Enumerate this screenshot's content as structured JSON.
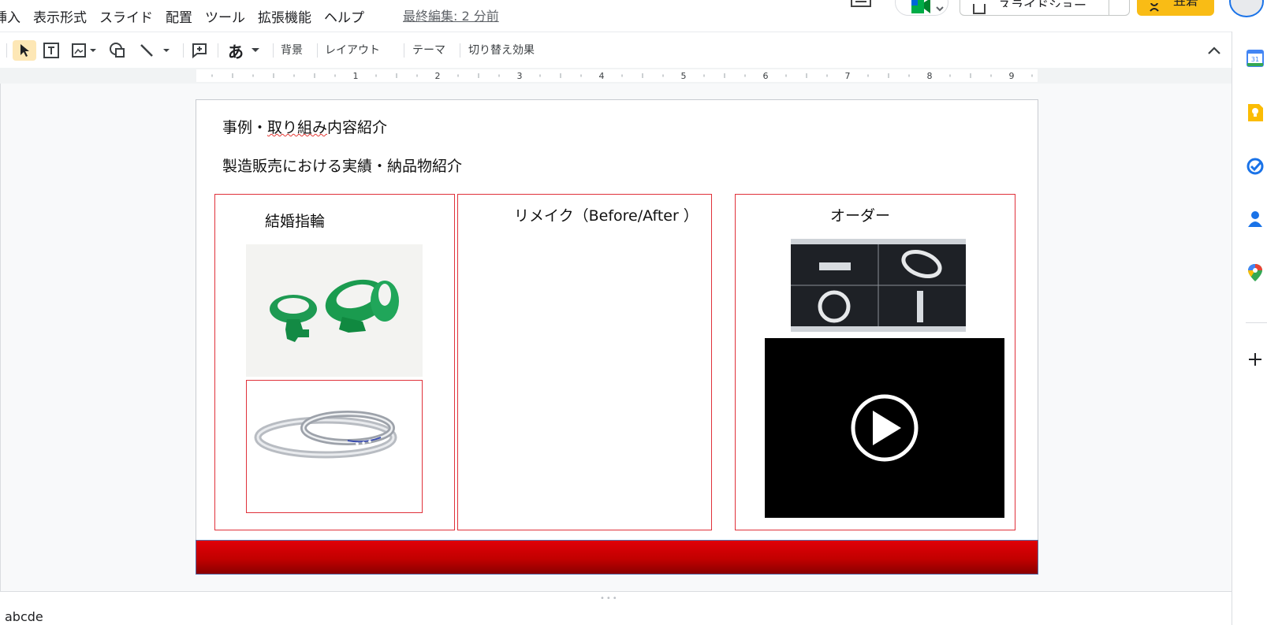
{
  "menu": {
    "items": [
      "挿入",
      "表示形式",
      "スライド",
      "配置",
      "ツール",
      "拡張機能",
      "ヘルプ"
    ],
    "last_edit": "最終編集: 2 分前"
  },
  "header": {
    "slideshow_label": "スライドショー",
    "share_label": "共有"
  },
  "toolbar": {
    "text_button": "あ",
    "background": "背景",
    "layout": "レイアウト",
    "theme": "テーマ",
    "transition": "切り替え効果"
  },
  "ruler": {
    "labels": [
      "1",
      "2",
      "3",
      "4",
      "5",
      "6",
      "7",
      "8",
      "9"
    ]
  },
  "slide": {
    "title_prefix": "事例・",
    "title_underlined": "取り組み",
    "title_suffix": "内容紹介",
    "subtitle": "製造販売における実績・納品物紹介",
    "columns": [
      {
        "label": "結婚指輪"
      },
      {
        "label": "リメイク（Before/After ）"
      },
      {
        "label": "オーダー"
      }
    ],
    "footer_color": "#c20000"
  },
  "notes": {
    "text": "abcde"
  },
  "side_panel": {
    "icons": [
      "calendar-icon",
      "keep-icon",
      "tasks-icon",
      "contacts-icon",
      "maps-icon",
      "add-icon"
    ]
  }
}
